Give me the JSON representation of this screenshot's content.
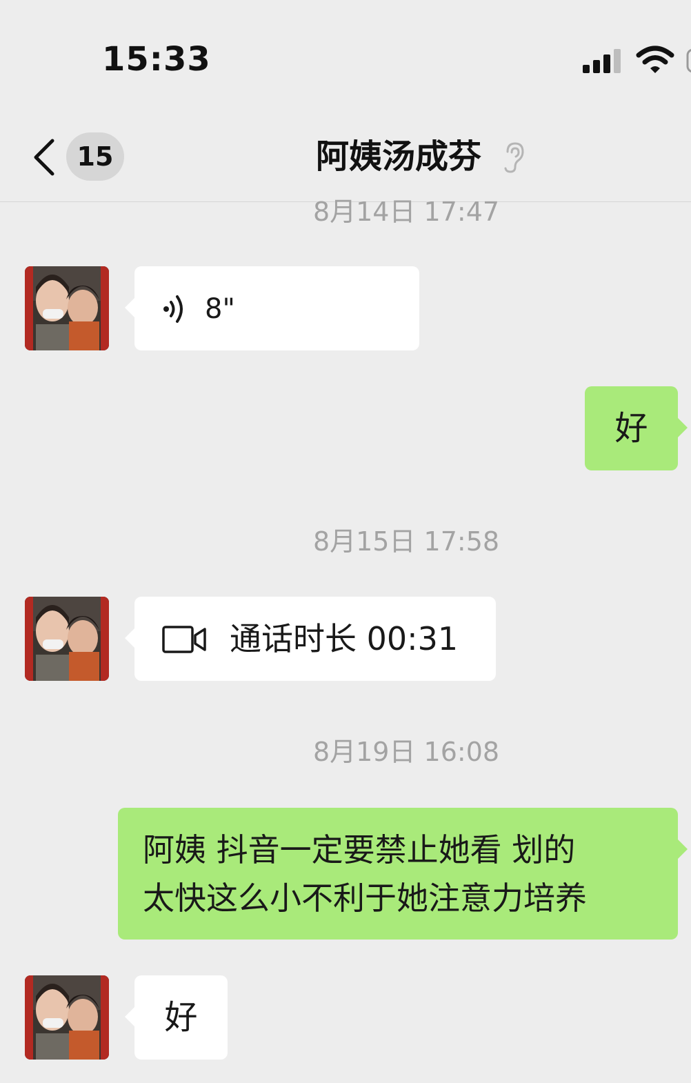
{
  "status": {
    "time": "15:33"
  },
  "nav": {
    "unread_count": "15",
    "title": "阿姨汤成芬"
  },
  "messages": [
    {
      "kind": "timestamp",
      "text": "8月14日 17:47"
    },
    {
      "kind": "voice",
      "from": "contact",
      "duration": "8\""
    },
    {
      "kind": "text",
      "from": "me",
      "text": "好"
    },
    {
      "kind": "timestamp",
      "text": "8月15日 17:58"
    },
    {
      "kind": "video-call",
      "from": "contact",
      "text": "通话时长 00:31"
    },
    {
      "kind": "timestamp",
      "text": "8月19日 16:08"
    },
    {
      "kind": "text",
      "from": "me",
      "lines": [
        "阿姨 抖音一定要禁止她看 划的",
        "太快这么小不利于她注意力培养"
      ]
    },
    {
      "kind": "text",
      "from": "contact",
      "text": "好"
    }
  ],
  "colors": {
    "background": "#ededed",
    "bubble_incoming": "#ffffff",
    "bubble_outgoing": "#a9ea7a",
    "timestamp_text": "#a3a3a3"
  }
}
